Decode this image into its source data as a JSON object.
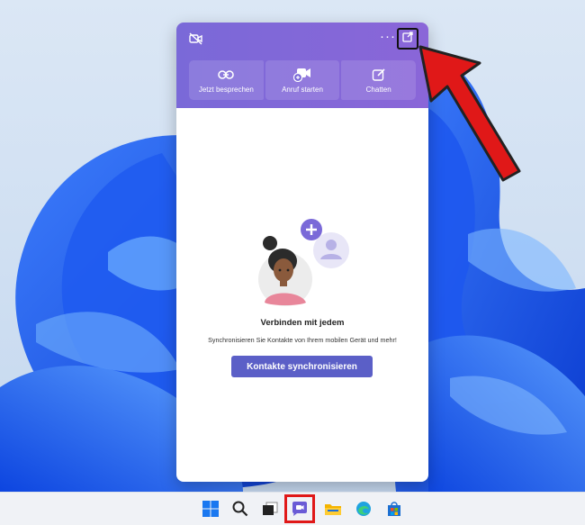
{
  "flyout": {
    "top_icons": [
      "camera-off-icon",
      "more-icon",
      "pop-out-icon"
    ],
    "more_label": "···",
    "actions": [
      {
        "label": "Jetzt besprechen",
        "icon": "link-icon"
      },
      {
        "label": "Anruf starten",
        "icon": "video-call-icon"
      },
      {
        "label": "Chatten",
        "icon": "compose-icon"
      }
    ],
    "empty_state": {
      "title": "Verbinden mit jedem",
      "subtitle": "Synchronisieren Sie Kontakte von Ihrem mobilen Gerät und mehr!",
      "button_label": "Kontakte synchronisieren"
    }
  },
  "annotation": {
    "color": "#e01818",
    "icon": "red-arrow"
  },
  "taskbar": {
    "items": [
      "start-icon",
      "search-icon",
      "task-view-icon",
      "chat-icon",
      "file-explorer-icon",
      "edge-icon",
      "store-icon"
    ]
  },
  "colors": {
    "accent": "#7a69d8",
    "button": "#5b5fc7",
    "highlight": "#e01818"
  }
}
